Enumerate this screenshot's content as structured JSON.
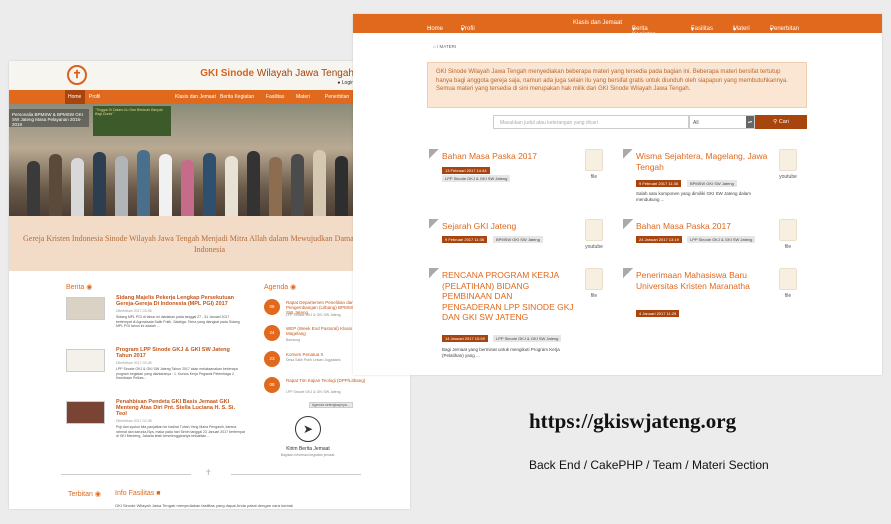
{
  "left": {
    "brand": "GKI Sinode",
    "brand_sub": "Wilayah Jawa Tengah",
    "login": "Login",
    "nav": [
      "Home",
      "Profil",
      "Klasis dan Jemaat",
      "Berita Kegiatan",
      "Fasilitas",
      "Materi",
      "Penerbitan"
    ],
    "hero_caption": "Personalia BPMSW & BPMSW GKI SW Jateng Masa Pelayanan 2015-2019",
    "hero_banner": "\"Tinggal Di Dalam-Ku Dan Berbuah Banyak Bagi Dunia\"",
    "tagline": "Gereja Kristen Indonesia Sinode Wilayah Jawa Tengah Menjadi Mitra Allah dalam Mewujudkan Damai Sejahtera di Indonesia",
    "berita_title": "Berita",
    "news": [
      {
        "title": "Sidang Majelis Pekerja Lengkap Persekutuan Gereja-Gereja Di Indonesia (MPL PGI) 2017",
        "date": "Diterbitkan 2017-03-08",
        "desc": "Sidang MPL PGI di tahun ini diadakan pada tanggal 27 - 31 Januari 2017 bertempat di Agrowisata Salib Putih, Salatiga. Tema yang diangkat pada Sidang MPL PGI tahun ini adalah ...",
        "more": "Selengkapnya"
      },
      {
        "title": "Program LPP Sinode GKJ & GKI SW Jateng Tahun 2017",
        "date": "Diterbitkan 2017-03-08",
        "desc": "LPP Sinode GKJ & GKI SW Jateng Tahun 2017 akan melaksanakan beberapa program kegiatan yang diantaranya : 1. Kursus Kerja Pegawai Pelembaga 2. Kemitraan Pelkes...",
        "more": "Selengkapnya"
      },
      {
        "title": "Penahbisan Pendeta GKI Basis Jemaat GKI Menteng Atas Diri Pnt. Stella Luciana H. S. Si. Teol",
        "date": "Diterbitkan 2017-02-08",
        "desc": "Puji dan syukur kita panjatkan ke hadirat Tuhan Yang Maha Pengasih, karena rahmat dan karunia-Nya, maka pada hari Senin tanggal 23 Januari 2017 bertempat di GKI Menteng, Jakarta telah terselenggaranya kebaktian ...",
        "more": "Selengkapnya"
      }
    ],
    "agenda_title": "Agenda",
    "agenda": [
      {
        "day": "06",
        "mon": "Feb",
        "title": "Rapat Departemen Penelitian dan Pengembangan (Litbang) BPMSW GKI SW Jateng",
        "sub": "LPP Sinode GKJ & GKI SW Jateng"
      },
      {
        "day": "24",
        "mon": "Feb",
        "title": "WEP (Week End Pastoral) Klasis Magelang",
        "sub": "Bandung"
      },
      {
        "day": "23",
        "mon": "Mar",
        "title": "Konven Penatua X",
        "sub": "Desa Salib Putih Lestari Jogjakarta"
      },
      {
        "day": "08",
        "mon": "Apr",
        "title": "Rapat Tim Kajian Teologi (DPP/Litbang)",
        "sub": "LPP Sinode GKJ & GKI SW Jateng"
      }
    ],
    "agenda_more": "Agenda selengkapnya...",
    "kirim_title": "Kirim Berita Jemaat",
    "kirim_sub": "Bagikan informasi kegiatan jemaat.",
    "terbitan_title": "Terbitan",
    "info_title": "Info Fasilitas",
    "info_desc": "GKI Sinode Wilayah Jawa Tengah menyediakan fasilitas yang dapat Anda pakai dengan cara kontak"
  },
  "right": {
    "nav": [
      "Home",
      "Profil",
      "Klasis dan Jemaat",
      "Berita Kegiatan",
      "Fasilitas",
      "Materi",
      "Penerbitan"
    ],
    "breadcrumb": "MATERI",
    "alert": "GKI Sinode Wilayah Jawa Tengah menyediakan beberapa materi yang tersedia pada bagian ini. Beberapa materi bersifat tertutup hanya bagi anggota gereja saja, namun ada juga selain itu yang bersifat gratis untuk diunduh oleh siapapun yang membutuhkannya. Semua materi yang tersedia di sini merupakan hak milik dari GKI Sinode Wilayah Jawa Tengah.",
    "search_placeholder": "Masukkan judul atau keterangan yang dicari",
    "select_value": "All",
    "search_button": "Cari",
    "cards": [
      {
        "title": "Bahan Masa Paska 2017",
        "date": "13 Februari 2017 14:44",
        "tag": "LPP Sinode GKJ & GKI SW Jateng",
        "desc": "",
        "kind": "file"
      },
      {
        "title": "Wisma Sejahtera, Magelang, Jawa Tengah",
        "date": "9 Februari 2017 11:36",
        "tag": "BPMSW GKI SW Jateng",
        "desc": "Salah satu komponen yang dimiliki GKI SW Jateng dalam mendukung ...",
        "kind": "youtube"
      },
      {
        "title": "Sejarah GKI Jateng",
        "date": "9 Februari 2017 11:36",
        "tag": "BPMSW GKI SW Jateng",
        "desc": "",
        "kind": "youtube"
      },
      {
        "title": "Bahan Masa Paska 2017",
        "date": "24 Januari 2017 13:19",
        "tag": "LPP Sinode GKJ & GKI SW Jateng",
        "desc": "",
        "kind": "file"
      },
      {
        "title": "RENCANA PROGRAM KERJA (PELATIHAN) BIDANG PEMBINAAN DAN PENGADERAN LPP SINODE GKJ DAN GKI SW JATENG",
        "date": "14 Januari 2017 10:59",
        "tag": "LPP Sinode GKJ & GKI SW Jateng",
        "desc": "Bagi Jemaat yang berminat untuk mengikuti Program Kerja (Pelatihan) yang ...",
        "kind": "file"
      },
      {
        "title": "Penerimaan Mahasiswa Baru Universitas Kristen Maranatha",
        "date": "4 Januari 2017 11:25",
        "tag": "",
        "desc": "",
        "kind": "file"
      }
    ]
  },
  "caption": {
    "url": "https://gkiswjateng.org",
    "sub": "Back End / CakePHP / Team / Materi Section"
  }
}
